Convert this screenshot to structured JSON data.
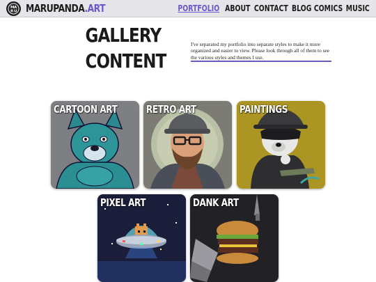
{
  "header": {
    "brand_name": "MARUPANDA",
    "brand_dot": ".",
    "brand_suffix": "ART",
    "logo_icon": "panda-logo-icon",
    "nav": [
      {
        "label": "PORTFOLIO",
        "active": true
      },
      {
        "label": "ABOUT",
        "active": false
      },
      {
        "label": "CONTACT",
        "active": false
      },
      {
        "label": "BLOG",
        "active": false
      },
      {
        "label": "COMICS",
        "active": false
      },
      {
        "label": "MUSIC",
        "active": false
      }
    ]
  },
  "intro": {
    "title_line1": "GALLERY",
    "title_line2": "CONTENT",
    "description": "I've separated my portfolio into separate styles to make it more organized and easier to view. Please look through all of them to see the various styles and themes I use."
  },
  "gallery": [
    {
      "label": "CARTOON ART"
    },
    {
      "label": "RETRO ART"
    },
    {
      "label": "PAINTINGS"
    },
    {
      "label": "PIXEL ART"
    },
    {
      "label": "DANK ART"
    }
  ],
  "colors": {
    "accent": "#6a58c9",
    "header_bg": "#e6e6ea",
    "text": "#1c1c1c"
  }
}
